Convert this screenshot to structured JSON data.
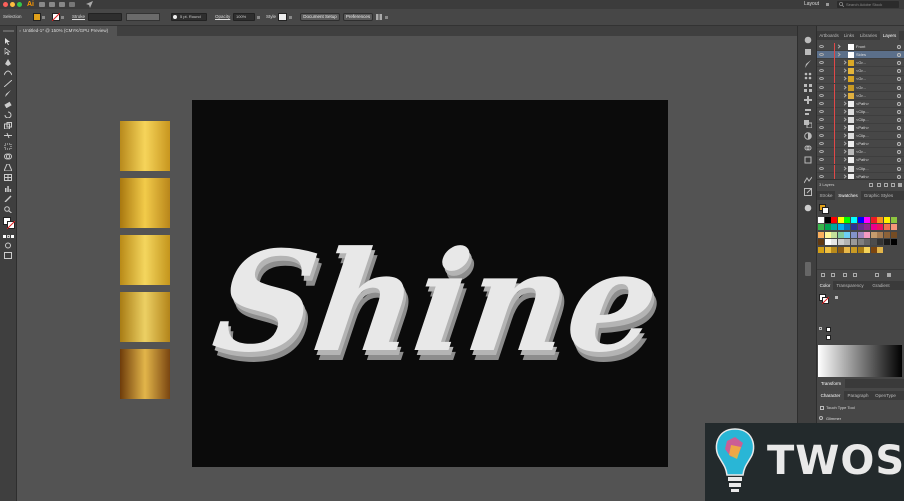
{
  "app": {
    "logo": "Ai",
    "workspace": "Layout",
    "search_placeholder": "Search Adobe Stock"
  },
  "control_bar": {
    "selection_label": "Selection",
    "stroke_label": "Stroke",
    "brush_value": "5 pt. Round",
    "opacity_label": "Opacity",
    "opacity_value": "100%",
    "style_label": "Style",
    "document_setup": "Document Setup",
    "preferences": "Preferences"
  },
  "document": {
    "tab_title": "Untitled-1* @ 150% (CMYK/GPU Preview)"
  },
  "artwork": {
    "headline": "Shine",
    "gold_colors": [
      [
        "#b88a1c",
        "#f6d45a",
        "#c8961e"
      ],
      [
        "#a9780f",
        "#f2cb4a",
        "#b9861a"
      ],
      [
        "#b98a17",
        "#f4d65e",
        "#c4951c"
      ],
      [
        "#a87c14",
        "#ecd064",
        "#b3841a"
      ],
      [
        "#6e3c0a",
        "#e2b54a",
        "#7a4510"
      ]
    ]
  },
  "layers_panel": {
    "tabs": [
      "Artboards",
      "Links",
      "Libraries",
      "Layers"
    ],
    "active_tab": "Layers",
    "rows": [
      {
        "name": "Front",
        "indent": 0,
        "thumb": "#ffffff"
      },
      {
        "name": "Sides",
        "indent": 0,
        "thumb": "#ffffff",
        "selected": true
      },
      {
        "name": "<Gr...",
        "indent": 1,
        "thumb": "#d9a826"
      },
      {
        "name": "<Gr...",
        "indent": 1,
        "thumb": "#e4b53a"
      },
      {
        "name": "<Gr...",
        "indent": 1,
        "thumb": "#d6a323"
      },
      {
        "name": "<Gr...",
        "indent": 1,
        "thumb": "#c99a24"
      },
      {
        "name": "<Gr...",
        "indent": 1,
        "thumb": "#e0b040"
      },
      {
        "name": "<Path>",
        "indent": 1,
        "thumb": "#eeeeee"
      },
      {
        "name": "<Clip...",
        "indent": 1,
        "thumb": "#dddddd"
      },
      {
        "name": "<Clip...",
        "indent": 1,
        "thumb": "#dddddd"
      },
      {
        "name": "<Path>",
        "indent": 1,
        "thumb": "#eeeeee"
      },
      {
        "name": "<Clip...",
        "indent": 1,
        "thumb": "#dddddd"
      },
      {
        "name": "<Path>",
        "indent": 1,
        "thumb": "#eeeeee"
      },
      {
        "name": "<Gr...",
        "indent": 1,
        "thumb": "#bbbbbb"
      },
      {
        "name": "<Path>",
        "indent": 1,
        "thumb": "#eeeeee"
      },
      {
        "name": "<Clip...",
        "indent": 1,
        "thumb": "#dddddd"
      },
      {
        "name": "<Path>",
        "indent": 1,
        "thumb": "#eeeeee"
      }
    ],
    "footer": "3 Layers"
  },
  "swatches_panel": {
    "tabs": [
      "Stroke",
      "Swatches",
      "Graphic Styles"
    ],
    "active_tab": "Swatches",
    "colors": [
      "#ffffff",
      "#000000",
      "#ff0000",
      "#ffff00",
      "#00ff00",
      "#00ffff",
      "#0000ff",
      "#ff00ff",
      "#ed1c24",
      "#f7941d",
      "#fff200",
      "#8dc63f",
      "#39b54a",
      "#00a651",
      "#00a99d",
      "#00aeef",
      "#0072bc",
      "#2e3192",
      "#662d91",
      "#92278f",
      "#ec008c",
      "#ed145b",
      "#f26c4f",
      "#f69679",
      "#fbaf5d",
      "#fff799",
      "#c4df9b",
      "#82ca9c",
      "#6dcff6",
      "#8393ca",
      "#a186be",
      "#f49ac1",
      "#c69c6d",
      "#a67c52",
      "#8c6239",
      "#754c24",
      "#603913",
      "#ffffff",
      "#e6e6e6",
      "#cccccc",
      "#b3b3b3",
      "#999999",
      "#808080",
      "#666666",
      "#4d4d4d",
      "#333333",
      "#1a1a1a",
      "#000000",
      "#d4a017",
      "#f0c040",
      "#b88a1c",
      "#8a5a12",
      "#e8b84a",
      "#c99a24",
      "#a97c14",
      "#f6d45a",
      "#7a4510",
      "#e2b54a"
    ]
  },
  "color_panel": {
    "tabs": [
      "Color",
      "Transparency",
      "Gradient"
    ],
    "active_tab": "Color",
    "gradient_colors": [
      "#ffffff",
      "#000000"
    ]
  },
  "collapsed_panels": {
    "transform": "Transform",
    "character_tabs": [
      "Character",
      "Paragraph",
      "OpenType"
    ],
    "touch_type": "Touch Type Tool",
    "font": "Glimmer"
  },
  "watermark": {
    "text": "TWOS"
  }
}
